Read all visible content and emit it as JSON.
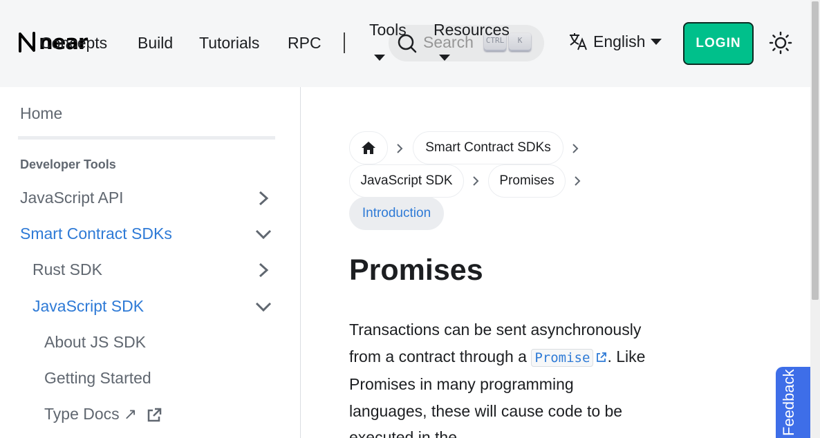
{
  "navbar": {
    "logo_text": "near",
    "links": {
      "concepts": "Concepts",
      "build": "Build",
      "tutorials": "Tutorials",
      "rpc": "RPC"
    },
    "dropdowns": {
      "tools": "Tools",
      "resources": "Resources"
    },
    "search": {
      "placeholder": "Search",
      "kbd_ctrl": "CTRL",
      "kbd_k": "K"
    },
    "language": "English",
    "login_label": "LOGIN"
  },
  "sidebar": {
    "home": "Home",
    "section_heading": "Developer Tools",
    "items": {
      "javascript_api": "JavaScript API",
      "smart_contract_sdks": "Smart Contract SDKs",
      "rust_sdk": "Rust SDK",
      "javascript_sdk": "JavaScript SDK",
      "about_js_sdk": "About JS SDK",
      "getting_started": "Getting Started",
      "type_docs": "Type Docs ↗"
    }
  },
  "breadcrumbs": [
    "Smart Contract SDKs",
    "JavaScript SDK",
    "Promises",
    "Introduction"
  ],
  "content": {
    "title": "Promises",
    "para_before": "Transactions can be sent asynchronously from a contract through a ",
    "code_text": "Promise",
    "para_after": ". Like Promises in many programming languages, these will cause code to be executed in the"
  },
  "feedback_label": "Feedback",
  "colors": {
    "accent": "#2e7ad6",
    "login_bg": "#00c08b",
    "feedback_bg": "#3e6ee8"
  }
}
